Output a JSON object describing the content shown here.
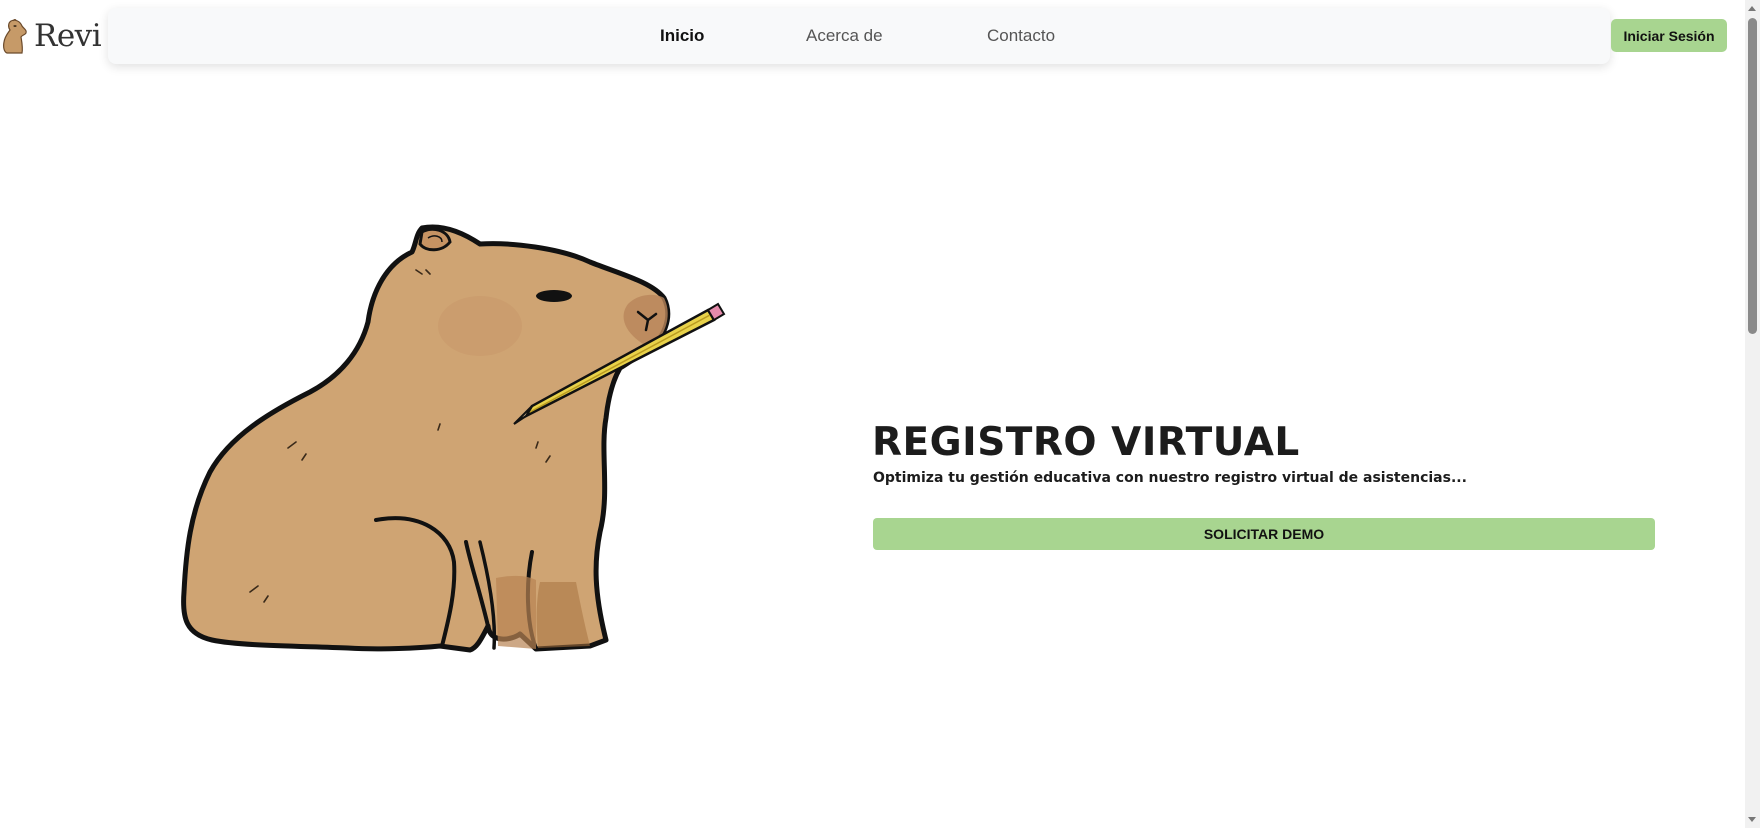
{
  "brand": {
    "name": "Revi",
    "logo_icon": "capybara-icon"
  },
  "nav": {
    "items": [
      {
        "label": "Inicio",
        "active": true
      },
      {
        "label": "Acerca de",
        "active": false
      },
      {
        "label": "Contacto",
        "active": false
      }
    ],
    "login_label": "Iniciar Sesión"
  },
  "hero": {
    "image": "capybara-with-pencil-illustration",
    "title": "REGISTRO VIRTUAL",
    "subtitle": "Optimiza tu gestión educativa con nuestro registro virtual de asistencias...",
    "cta_label": "SOLICITAR DEMO"
  },
  "colors": {
    "accent": "#a8d590",
    "navbar_bg": "#f8f9fa",
    "text": "#1c1c1c"
  }
}
